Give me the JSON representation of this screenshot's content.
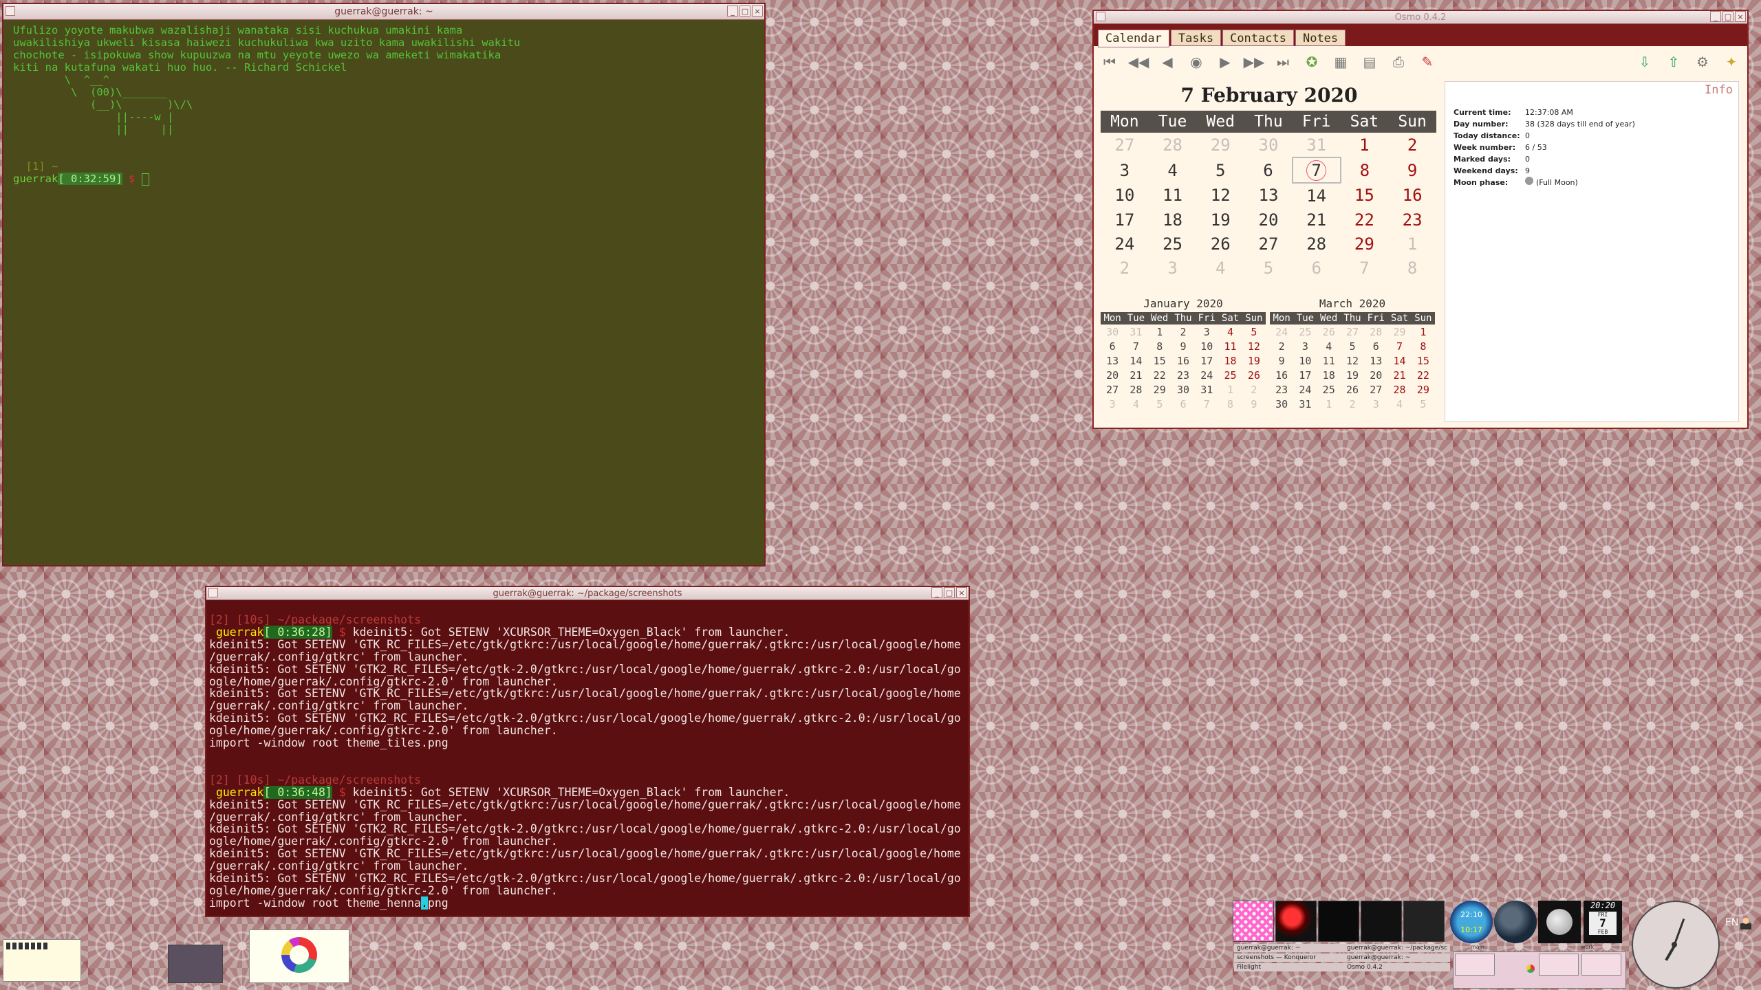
{
  "term1": {
    "title": "guerrak@guerrak: ~",
    "lines": [
      "Ufulizo yoyote makubwa wazalishaji wanataka sisi kuchukua umakini kama",
      "uwakilishiya ukweli kisasa haiwezi kuchukuliwa kwa uzito kama uwakilishi wakitu",
      "chochote - isipokuwa show kupuuzwa na mtu yeyote uwezo wa ameketi wimakatika",
      "kiti na kutafuna wakati huo huo. -- Richard Schickel",
      "        \\  ^__^",
      "         \\  (00)\\_______",
      "            (__)\\       )\\/\\",
      "                ||----w |",
      "                ||     ||",
      "",
      "",
      "  [1] ~"
    ],
    "prompt_user": "guerrak",
    "prompt_time": "[ 0:32:59]"
  },
  "term2": {
    "title": "guerrak@guerrak: ~/package/screenshots",
    "block1_header": "[2] [10s] ~/package/screenshots",
    "block1_time": "[ 0:36:28]",
    "block1_lines": [
      "kdeinit5: Got SETENV 'GTK_RC_FILES=/etc/gtk/gtkrc:/usr/local/google/home/guerrak/.gtkrc:/usr/local/google/home",
      "/guerrak/.config/gtkrc' from launcher.",
      "kdeinit5: Got SETENV 'GTK2_RC_FILES=/etc/gtk-2.0/gtkrc:/usr/local/google/home/guerrak/.gtkrc-2.0:/usr/local/go",
      "ogle/home/guerrak/.config/gtkrc-2.0' from launcher.",
      "kdeinit5: Got SETENV 'GTK_RC_FILES=/etc/gtk/gtkrc:/usr/local/google/home/guerrak/.gtkrc:/usr/local/google/home",
      "/guerrak/.config/gtkrc' from launcher.",
      "kdeinit5: Got SETENV 'GTK2_RC_FILES=/etc/gtk-2.0/gtkrc:/usr/local/google/home/guerrak/.gtkrc-2.0:/usr/local/go",
      "ogle/home/guerrak/.config/gtkrc-2.0' from launcher.",
      "import -window root theme_tiles.png"
    ],
    "block2_header": "[2] [10s] ~/package/screenshots",
    "block2_time": "[ 0:36:48]",
    "block2_lines": [
      "kdeinit5: Got SETENV 'GTK_RC_FILES=/etc/gtk/gtkrc:/usr/local/google/home/guerrak/.gtkrc:/usr/local/google/home",
      "/guerrak/.config/gtkrc' from launcher.",
      "kdeinit5: Got SETENV 'GTK2_RC_FILES=/etc/gtk-2.0/gtkrc:/usr/local/google/home/guerrak/.gtkrc-2.0:/usr/local/go",
      "ogle/home/guerrak/.config/gtkrc-2.0' from launcher.",
      "kdeinit5: Got SETENV 'GTK_RC_FILES=/etc/gtk/gtkrc:/usr/local/google/home/guerrak/.gtkrc:/usr/local/google/home",
      "/guerrak/.config/gtkrc' from launcher.",
      "kdeinit5: Got SETENV 'GTK2_RC_FILES=/etc/gtk-2.0/gtkrc:/usr/local/google/home/guerrak/.gtkrc-2.0:/usr/local/go",
      "ogle/home/guerrak/.config/gtkrc-2.0' from launcher."
    ],
    "prompt_user": "guerrak",
    "cmd_xcursor": "kdeinit5: Got SETENV 'XCURSOR_THEME=Oxygen_Black' from launcher.",
    "last_cmd_before": "import -window root theme_henna",
    "last_cmd_cursor": ".",
    "last_cmd_after": "png"
  },
  "osmo": {
    "title": "Osmo 0.4.2",
    "tabs": [
      "Calendar",
      "Tasks",
      "Contacts",
      "Notes"
    ],
    "date_heading": "7 February 2020",
    "weekdays": [
      "Mon",
      "Tue",
      "Wed",
      "Thu",
      "Fri",
      "Sat",
      "Sun"
    ],
    "feb_weeks": [
      [
        "27",
        "28",
        "29",
        "30",
        "31",
        "1",
        "2"
      ],
      [
        "3",
        "4",
        "5",
        "6",
        "7",
        "8",
        "9"
      ],
      [
        "10",
        "11",
        "12",
        "13",
        "14",
        "15",
        "16"
      ],
      [
        "17",
        "18",
        "19",
        "20",
        "21",
        "22",
        "23"
      ],
      [
        "24",
        "25",
        "26",
        "27",
        "28",
        "29",
        "1"
      ],
      [
        "2",
        "3",
        "4",
        "5",
        "6",
        "7",
        "8"
      ]
    ],
    "jan_title": "January 2020",
    "jan_weeks": [
      [
        "30",
        "31",
        "1",
        "2",
        "3",
        "4",
        "5"
      ],
      [
        "6",
        "7",
        "8",
        "9",
        "10",
        "11",
        "12"
      ],
      [
        "13",
        "14",
        "15",
        "16",
        "17",
        "18",
        "19"
      ],
      [
        "20",
        "21",
        "22",
        "23",
        "24",
        "25",
        "26"
      ],
      [
        "27",
        "28",
        "29",
        "30",
        "31",
        "1",
        "2"
      ],
      [
        "3",
        "4",
        "5",
        "6",
        "7",
        "8",
        "9"
      ]
    ],
    "mar_title": "March 2020",
    "mar_weeks": [
      [
        "24",
        "25",
        "26",
        "27",
        "28",
        "29",
        "1"
      ],
      [
        "2",
        "3",
        "4",
        "5",
        "6",
        "7",
        "8"
      ],
      [
        "9",
        "10",
        "11",
        "12",
        "13",
        "14",
        "15"
      ],
      [
        "16",
        "17",
        "18",
        "19",
        "20",
        "21",
        "22"
      ],
      [
        "23",
        "24",
        "25",
        "26",
        "27",
        "28",
        "29"
      ],
      [
        "30",
        "31",
        "1",
        "2",
        "3",
        "4",
        "5"
      ]
    ],
    "small_weekdays": [
      "Mon",
      "Tue",
      "Wed",
      "Thu",
      "Fri",
      "Sat",
      "Sun"
    ],
    "info_title": "Info",
    "info": [
      {
        "k": "Current time:",
        "v": "12:37:08 AM"
      },
      {
        "k": "Day number:",
        "v": "38 (328 days till end of year)"
      },
      {
        "k": "Today distance:",
        "v": "0"
      },
      {
        "k": "Week number:",
        "v": "6 / 53"
      },
      {
        "k": "Marked days:",
        "v": "0"
      },
      {
        "k": "Weekend days:",
        "v": "9"
      },
      {
        "k": "Moon phase:",
        "v": "(Full Moon)"
      }
    ]
  },
  "tray": {
    "clock_top": "22:10",
    "clock_bottom": "10:17",
    "date_time": "20:20",
    "date_day": "FRI",
    "date_num": "7",
    "date_month": "FEB",
    "lang": "EN",
    "tasks": [
      "guerrak@guerrak: ~",
      "screenshots — Konqueror",
      "Filelight",
      "guerrak@guerrak: ~/package/sc",
      "guerrak@guerrak: ~",
      "Osmo 0.4.2"
    ],
    "pager_labels": [
      "main",
      "work"
    ]
  }
}
